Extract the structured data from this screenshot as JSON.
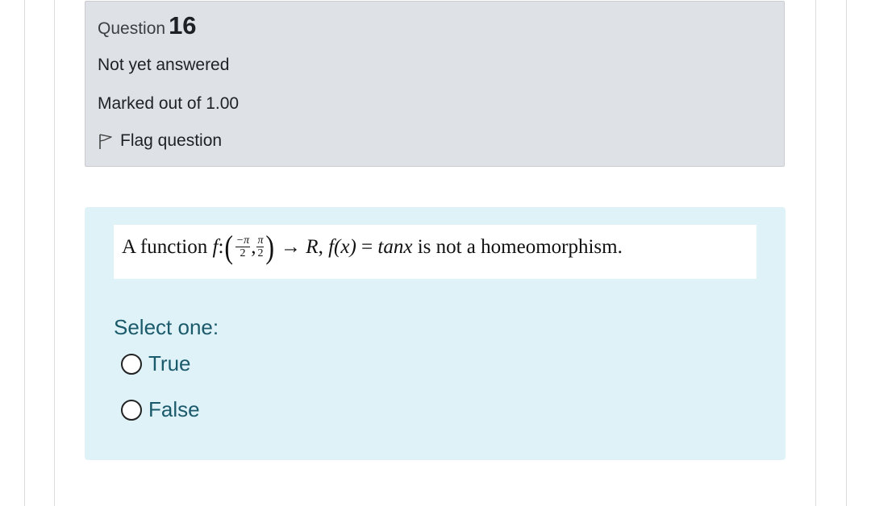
{
  "question_info": {
    "label": "Question",
    "number": "16",
    "state": "Not yet answered",
    "grade": "Marked out of 1.00",
    "flag_label": "Flag question"
  },
  "question_text": {
    "prefix": "A function",
    "f": "f",
    "colon": ":",
    "frac1_num": "−π",
    "frac1_den": "2",
    "comma": ",",
    "frac2_num": "π",
    "frac2_den": "2",
    "arrow": "→",
    "codomain": "R",
    "fx": "f(x)",
    "equals": "=",
    "rhs": "tanx",
    "suffix": "is not a homeomorphism."
  },
  "answer": {
    "prompt": "Select one:",
    "options": [
      {
        "label": "True",
        "selected": false
      },
      {
        "label": "False",
        "selected": false
      }
    ]
  },
  "colors": {
    "info_bg": "#dee2e6",
    "content_bg": "#def2f8",
    "answer_text": "#1b5a6b"
  },
  "icons": {
    "flag": "flag-outline-icon",
    "radio": "radio-unchecked-icon"
  }
}
